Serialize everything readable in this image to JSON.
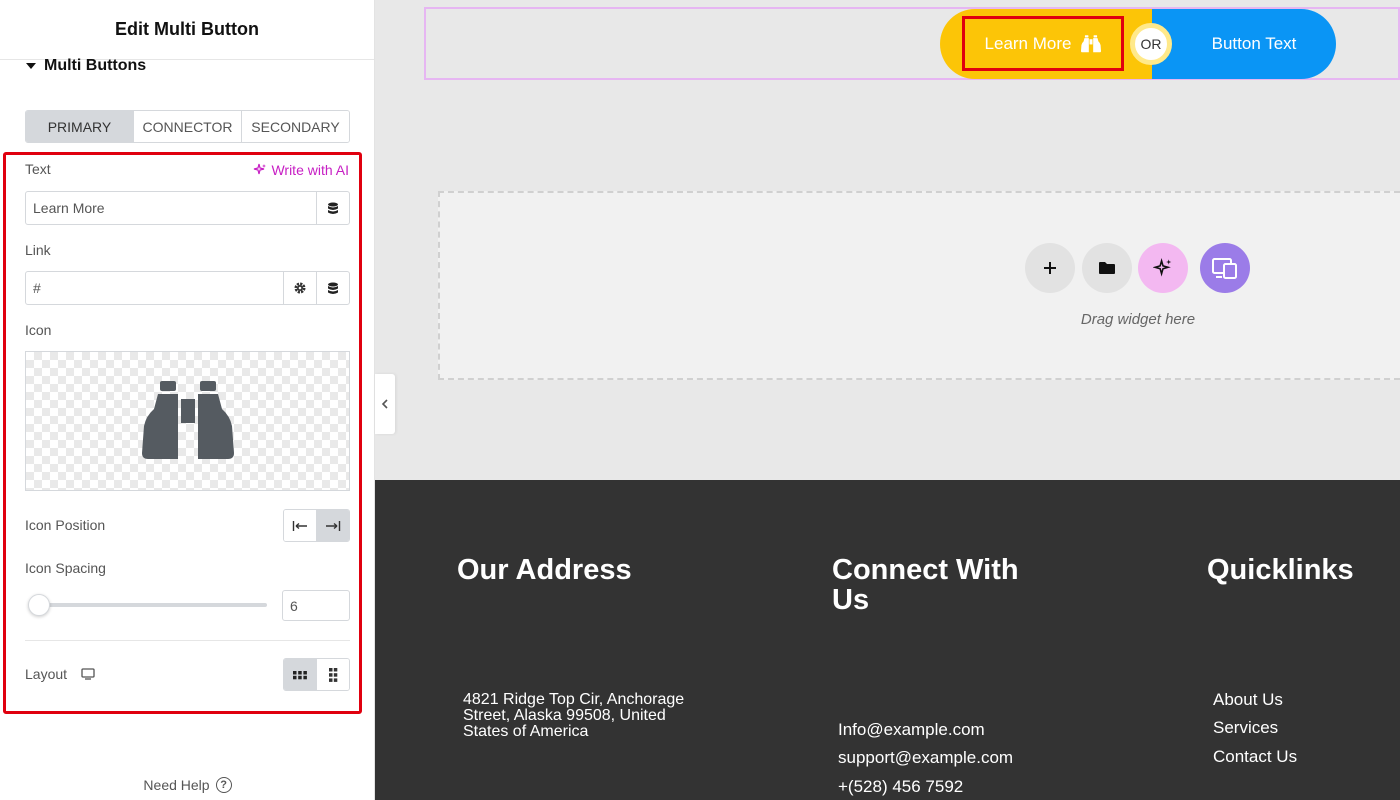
{
  "panel": {
    "title": "Edit Multi Button",
    "section_title": "Multi Buttons",
    "tabs": [
      "PRIMARY",
      "CONNECTOR",
      "SECONDARY"
    ],
    "active_tab": "PRIMARY",
    "text_label": "Text",
    "write_ai": "Write with AI",
    "text_value": "Learn More",
    "link_label": "Link",
    "link_value": "#",
    "icon_label": "Icon",
    "icon_name": "binoculars-icon",
    "icon_position_label": "Icon Position",
    "icon_spacing_label": "Icon Spacing",
    "icon_spacing_value": "6",
    "layout_label": "Layout",
    "need_help": "Need Help"
  },
  "canvas": {
    "primary_button_text": "Learn More",
    "connector_text": "OR",
    "secondary_button_text": "Button Text",
    "drop_zone_text": "Drag widget here"
  },
  "footer": {
    "address_heading": "Our Address",
    "address_text": [
      "4821 Ridge Top Cir, Anchorage",
      "Street, Alaska 99508, United",
      "States of America"
    ],
    "connect_heading_line1": "Connect With",
    "connect_heading_line2": "Us",
    "email1": "Info@example.com",
    "email2": "support@example.com",
    "phone": "+(528) 456 7592",
    "quicklinks_heading": "Quicklinks",
    "links": [
      "About Us",
      "Services",
      "Contact Us"
    ]
  },
  "colors": {
    "primary_button": "#fcc507",
    "secondary_button": "#0a95f5",
    "highlight": "#e0000f",
    "ai_accent": "#c71fc4",
    "footer_bg": "#333333"
  }
}
